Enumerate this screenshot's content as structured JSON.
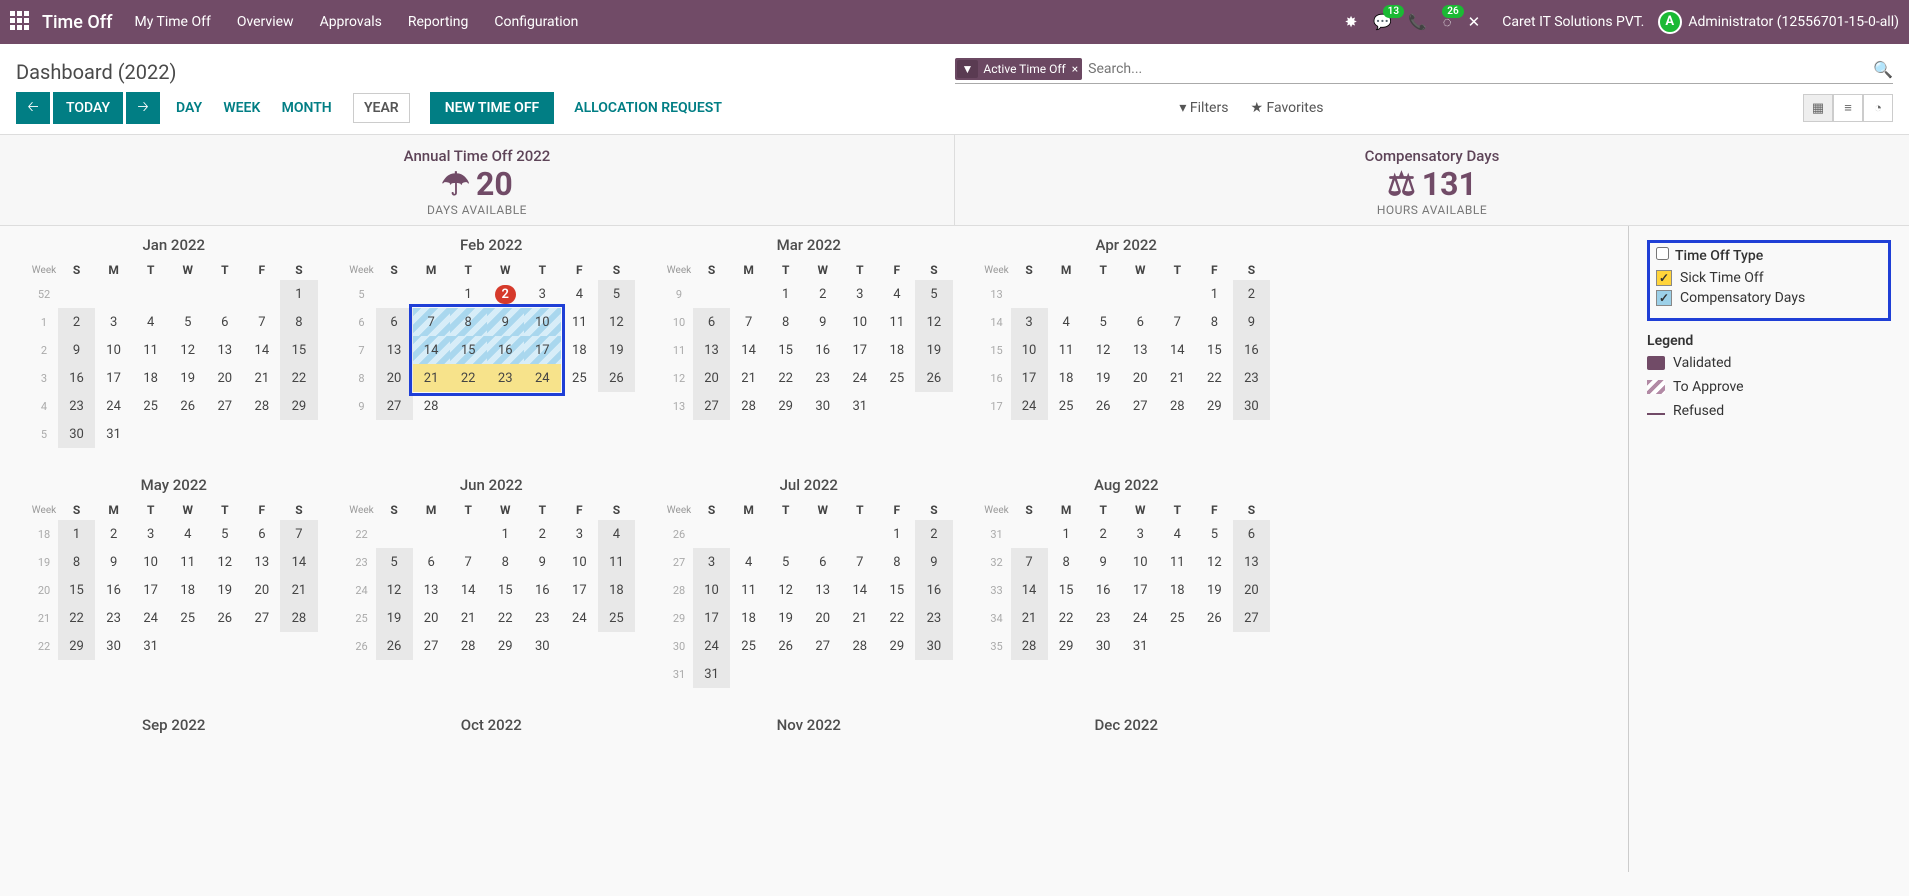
{
  "nav": {
    "brand": "Time Off",
    "menus": [
      "My Time Off",
      "Overview",
      "Approvals",
      "Reporting",
      "Configuration"
    ],
    "msg_badge": "13",
    "act_badge": "26",
    "company": "Caret IT Solutions PVT.",
    "user": "Administrator (12556701-15-0-all)"
  },
  "cp": {
    "title": "Dashboard (2022)",
    "chip": "Active Time Off",
    "placeholder": "Search..."
  },
  "toolbar": {
    "today": "TODAY",
    "views": [
      "DAY",
      "WEEK",
      "MONTH",
      "YEAR"
    ],
    "active_view": "YEAR",
    "new": "NEW TIME OFF",
    "alloc": "ALLOCATION REQUEST",
    "filters": "Filters",
    "fav": "Favorites"
  },
  "kpis": [
    {
      "title": "Annual Time Off 2022",
      "value": "20",
      "unit": "DAYS AVAILABLE",
      "icon": "☂"
    },
    {
      "title": "Compensatory Days",
      "value": "131",
      "unit": "HOURS AVAILABLE",
      "icon": "⚖"
    }
  ],
  "side": {
    "group": "Time Off Type",
    "types": [
      "Sick Time Off",
      "Compensatory Days"
    ],
    "legend_title": "Legend",
    "legend": [
      "Validated",
      "To Approve",
      "Refused"
    ]
  },
  "cal": {
    "dow": [
      "S",
      "M",
      "T",
      "W",
      "T",
      "F",
      "S"
    ],
    "wk": "Week",
    "months": [
      {
        "name": "Jan 2022",
        "wstart": 52,
        "skip": 6,
        "days": 31,
        "off_dow": [
          0,
          6
        ]
      },
      {
        "name": "Feb 2022",
        "wstart": 5,
        "skip": 2,
        "days": 28,
        "off_dow": [
          0,
          6
        ],
        "today": 2,
        "pend": [
          7,
          8,
          9,
          10,
          14,
          15,
          16,
          17
        ],
        "val": [
          21,
          22,
          23,
          24
        ]
      },
      {
        "name": "Mar 2022",
        "wstart": 9,
        "skip": 2,
        "days": 31,
        "off_dow": [
          0,
          6
        ]
      },
      {
        "name": "Apr 2022",
        "wstart": 13,
        "skip": 5,
        "days": 30,
        "off_dow": [
          0,
          6
        ]
      },
      {
        "name": "May 2022",
        "wstart": 18,
        "skip": 0,
        "days": 31,
        "off_dow": [
          0,
          6
        ]
      },
      {
        "name": "Jun 2022",
        "wstart": 22,
        "skip": 3,
        "days": 30,
        "off_dow": [
          0,
          6
        ]
      },
      {
        "name": "Jul 2022",
        "wstart": 26,
        "skip": 5,
        "days": 31,
        "off_dow": [
          0,
          6
        ]
      },
      {
        "name": "Aug 2022",
        "wstart": 31,
        "skip": 1,
        "days": 31,
        "off_dow": [
          0,
          6
        ]
      },
      {
        "name": "Sep 2022"
      },
      {
        "name": "Oct 2022"
      },
      {
        "name": "Nov 2022"
      },
      {
        "name": "Dec 2022"
      }
    ]
  }
}
